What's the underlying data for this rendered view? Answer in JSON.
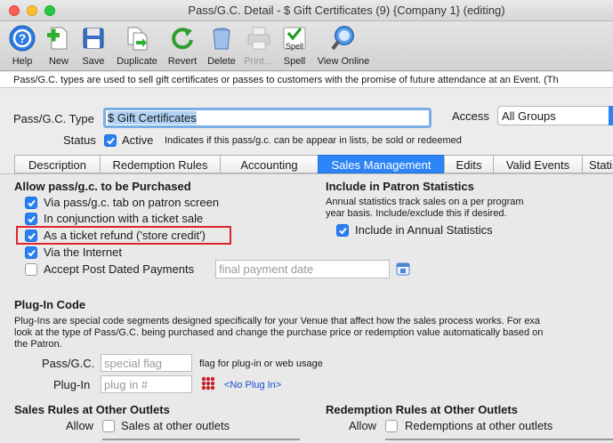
{
  "window": {
    "title": "Pass/G.C. Detail - $ Gift Certificates (9) {Company 1} (editing)"
  },
  "toolbar": {
    "help": "Help",
    "new": "New",
    "save": "Save",
    "duplicate": "Duplicate",
    "revert": "Revert",
    "delete": "Delete",
    "print": "Print…",
    "spell": "Spell",
    "view_online": "View Online",
    "spell_icon_text": "Spell"
  },
  "info": {
    "text": "Pass/G.C. types are used to sell gift certificates or passes to customers with the promise of future attendance at an Event.  (Th"
  },
  "form": {
    "type_label": "Pass/G.C. Type",
    "type_value": "$ Gift Certificates",
    "access_label": "Access",
    "access_value": "All Groups",
    "status_label": "Status",
    "status_checked": true,
    "active_label": "Active",
    "active_hint": "Indicates if this pass/g.c. can be appear in lists, be sold or redeemed"
  },
  "tabs": [
    "Description",
    "Redemption Rules",
    "Accounting",
    "Sales Management",
    "Edits",
    "Valid Events",
    "Statist"
  ],
  "active_tab": "Sales Management",
  "allow": {
    "heading": "Allow pass/g.c. to be Purchased",
    "items": [
      {
        "label": "Via pass/g.c. tab on patron screen",
        "checked": true
      },
      {
        "label": "In conjunction with a ticket sale",
        "checked": true
      },
      {
        "label": "As a ticket refund ('store credit')",
        "checked": true
      },
      {
        "label": "Via the Internet",
        "checked": true
      },
      {
        "label": "Accept Post Dated Payments",
        "checked": false
      }
    ],
    "final_payment_placeholder": "final payment date"
  },
  "stats": {
    "heading": "Include in Patron Statistics",
    "desc1": "Annual statistics track sales on a per program",
    "desc2": "year basis.  Include/exclude this if desired.",
    "include_label": "Include in Annual Statistics",
    "include_checked": true
  },
  "plugin": {
    "heading": "Plug-In Code",
    "desc1": "Plug-Ins are special code segments designed specifically for your Venue that affect how the sales process works.   For exa",
    "desc2": "look at the type of Pass/G.C. being purchased and change the purchase price or redemption value automatically based on",
    "desc3": "the Patron.",
    "pass_label": "Pass/G.C.",
    "pass_placeholder": "special flag",
    "pass_hint": "flag for plug-in or web usage",
    "plugin_label": "Plug-In",
    "plugin_placeholder": "plug in #",
    "no_plugin_link": "<No Plug In>"
  },
  "outlets": {
    "sales_heading": "Sales Rules at Other Outlets",
    "sales_allow": "Allow",
    "sales_label": "Sales at other outlets",
    "sales_checked": false,
    "redemption_heading": "Redemption Rules at Other Outlets",
    "redemption_allow": "Allow",
    "redemption_label": "Redemptions at other outlets",
    "redemption_checked": false
  }
}
